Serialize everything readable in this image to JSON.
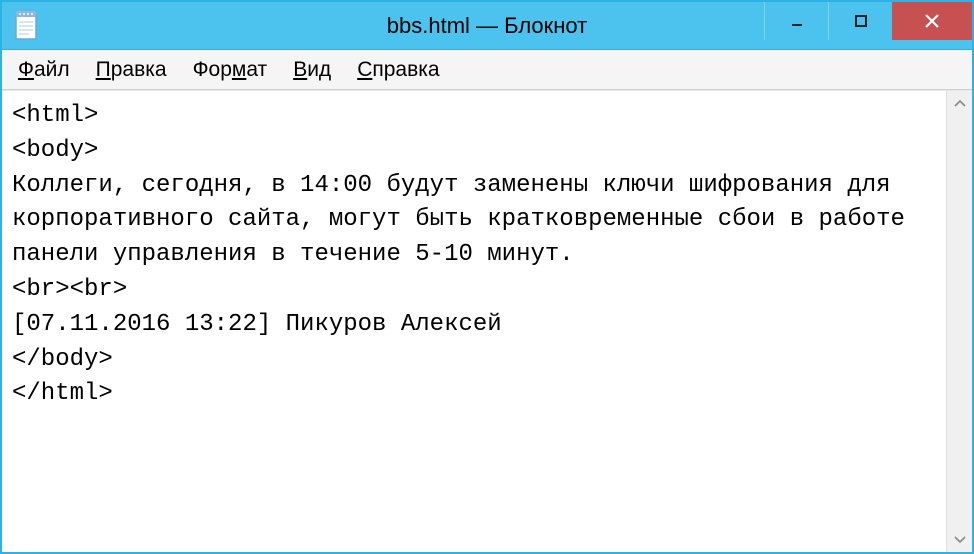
{
  "window": {
    "title": "bbs.html — Блокнот"
  },
  "menu": {
    "file": {
      "accel": "Ф",
      "rest": "айл"
    },
    "edit": {
      "accel": "П",
      "rest": "равка"
    },
    "format": {
      "pre": "Фор",
      "accel": "м",
      "rest": "ат"
    },
    "view": {
      "accel": "В",
      "rest": "ид"
    },
    "help": {
      "accel": "С",
      "rest": "правка"
    }
  },
  "content": {
    "text": "<html>\n<body>\nКоллеги, сегодня, в 14:00 будут заменены ключи шифрования для корпоративного сайта, могут быть кратковременные сбои в работе панели управления в течение 5-10 минут.\n<br><br>\n[07.11.2016 13:22] Пикуров Алексей\n</body>\n</html>"
  }
}
